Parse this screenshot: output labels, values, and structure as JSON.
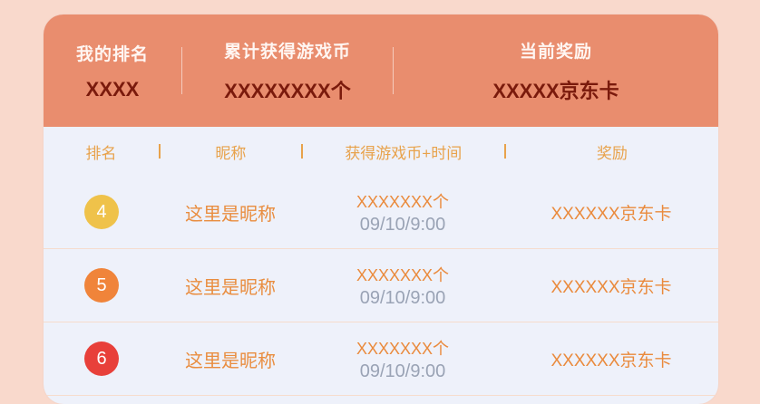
{
  "summary": {
    "rank_label": "我的排名",
    "rank_value": "XXXX",
    "coins_label": "累计获得游戏币",
    "coins_value": "XXXXXXXX个",
    "reward_label": "当前奖励",
    "reward_value": "XXXXX京东卡"
  },
  "table": {
    "headers": {
      "rank": "排名",
      "nickname": "昵称",
      "coins_time": "获得游戏币+时间",
      "reward": "奖励"
    },
    "rows": [
      {
        "rank": "4",
        "rank_color": "#efc24a",
        "nickname": "这里是昵称",
        "coins": "XXXXXXX个",
        "time": "09/10/9:00",
        "reward": "XXXXXX京东卡"
      },
      {
        "rank": "5",
        "rank_color": "#f0843a",
        "nickname": "这里是昵称",
        "coins": "XXXXXXX个",
        "time": "09/10/9:00",
        "reward": "XXXXXX京东卡"
      },
      {
        "rank": "6",
        "rank_color": "#e8403a",
        "nickname": "这里是昵称",
        "coins": "XXXXXXX个",
        "time": "09/10/9:00",
        "reward": "XXXXXX京东卡"
      }
    ]
  }
}
